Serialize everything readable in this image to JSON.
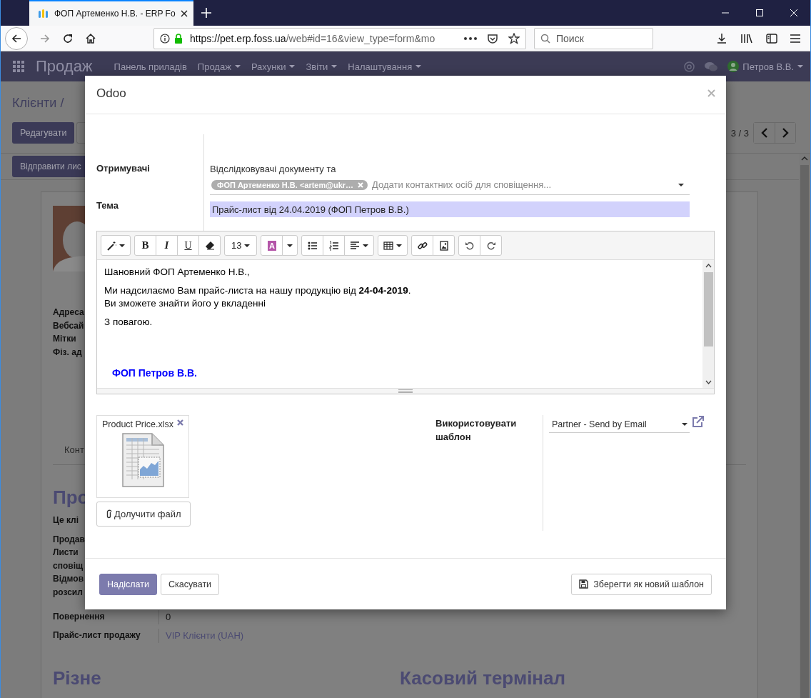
{
  "browser": {
    "tabs": [
      {
        "title": "ФОП Артеменко Н.В. - ERP Fo",
        "selected": true
      }
    ],
    "address": {
      "host": "https://pet.erp.foss.ua",
      "path": "/web#id=16&view_type=form&mo"
    },
    "search": {
      "placeholder": "Поиск"
    }
  },
  "app_bar": {
    "app": "Продаж",
    "menu": [
      {
        "label": "Панель приладів",
        "dropdown": false
      },
      {
        "label": "Продаж",
        "dropdown": true
      },
      {
        "label": "Рахунки",
        "dropdown": true
      },
      {
        "label": "Звіти",
        "dropdown": true
      },
      {
        "label": "Налаштування",
        "dropdown": true
      }
    ],
    "user": {
      "name": "Петров В.В.",
      "dropdown": true
    }
  },
  "control_panel": {
    "breadcrumb": "Клієнти /",
    "edit_button": "Редагувати",
    "pager": "3 / 3"
  },
  "status_bar": {
    "button": "Відправити лис"
  },
  "sheet": {
    "contact_labels": [
      "Адреса",
      "Вебсай",
      "Мітки",
      "Фіз. ад"
    ],
    "tab": "Конт",
    "section_title": "Про",
    "fields": [
      {
        "label": "Це клі"
      },
      {
        "label": "Продав"
      },
      {
        "label": "Листи\nсповіщ"
      },
      {
        "label": "Відмов\nрозсил"
      },
      {
        "label": "Повернення",
        "value": "0",
        "kind": "plain"
      },
      {
        "label": "Прайс-лист продажу",
        "value": "VIP Клієнти (UAH)",
        "kind": "link"
      }
    ],
    "sections": [
      {
        "title": "Різне"
      },
      {
        "title": "Касовий термінал"
      }
    ]
  },
  "dialog": {
    "title": "Odoo",
    "recipients": {
      "label": "Отримувачі",
      "note": "Відслідковувачі документу та",
      "tags": [
        {
          "label": "ФОП Артеменко Н.В. <artem@ukr…"
        }
      ],
      "placeholder": "Додати контактних осіб для сповіщення..."
    },
    "subject": {
      "label": "Тема",
      "value": "Прайс-лист від 24.04.2019 (ФОП Петров В.В.)"
    },
    "editor": {
      "toolbar": {
        "bold": "B",
        "italic": "I",
        "underline": "U",
        "font_size": "13",
        "font_color_letter": "A"
      },
      "paragraphs": [
        [
          "Шановний ФОП Артеменко Н.В.,"
        ],
        [
          "Ми надсилаємо Вам прайс-листа на нашу продукцію від **24-04-2019**.",
          "Ви зможете знайти його у вкладенні"
        ],
        [
          "З повагою."
        ]
      ],
      "signature": "ФОП Петров В.В."
    },
    "attachments": [
      {
        "name": "Product Price.xlsx"
      }
    ],
    "attach_button": "Долучити файл",
    "template": {
      "label": "Використовувати шаблон",
      "value": "Partner - Send by Email"
    },
    "buttons": [
      {
        "label": "Надіслати",
        "kind": "primary"
      },
      {
        "label": "Скасувати",
        "kind": "secondary"
      },
      {
        "label": "Зберегти як новий шаблон",
        "kind": "save"
      }
    ]
  }
}
